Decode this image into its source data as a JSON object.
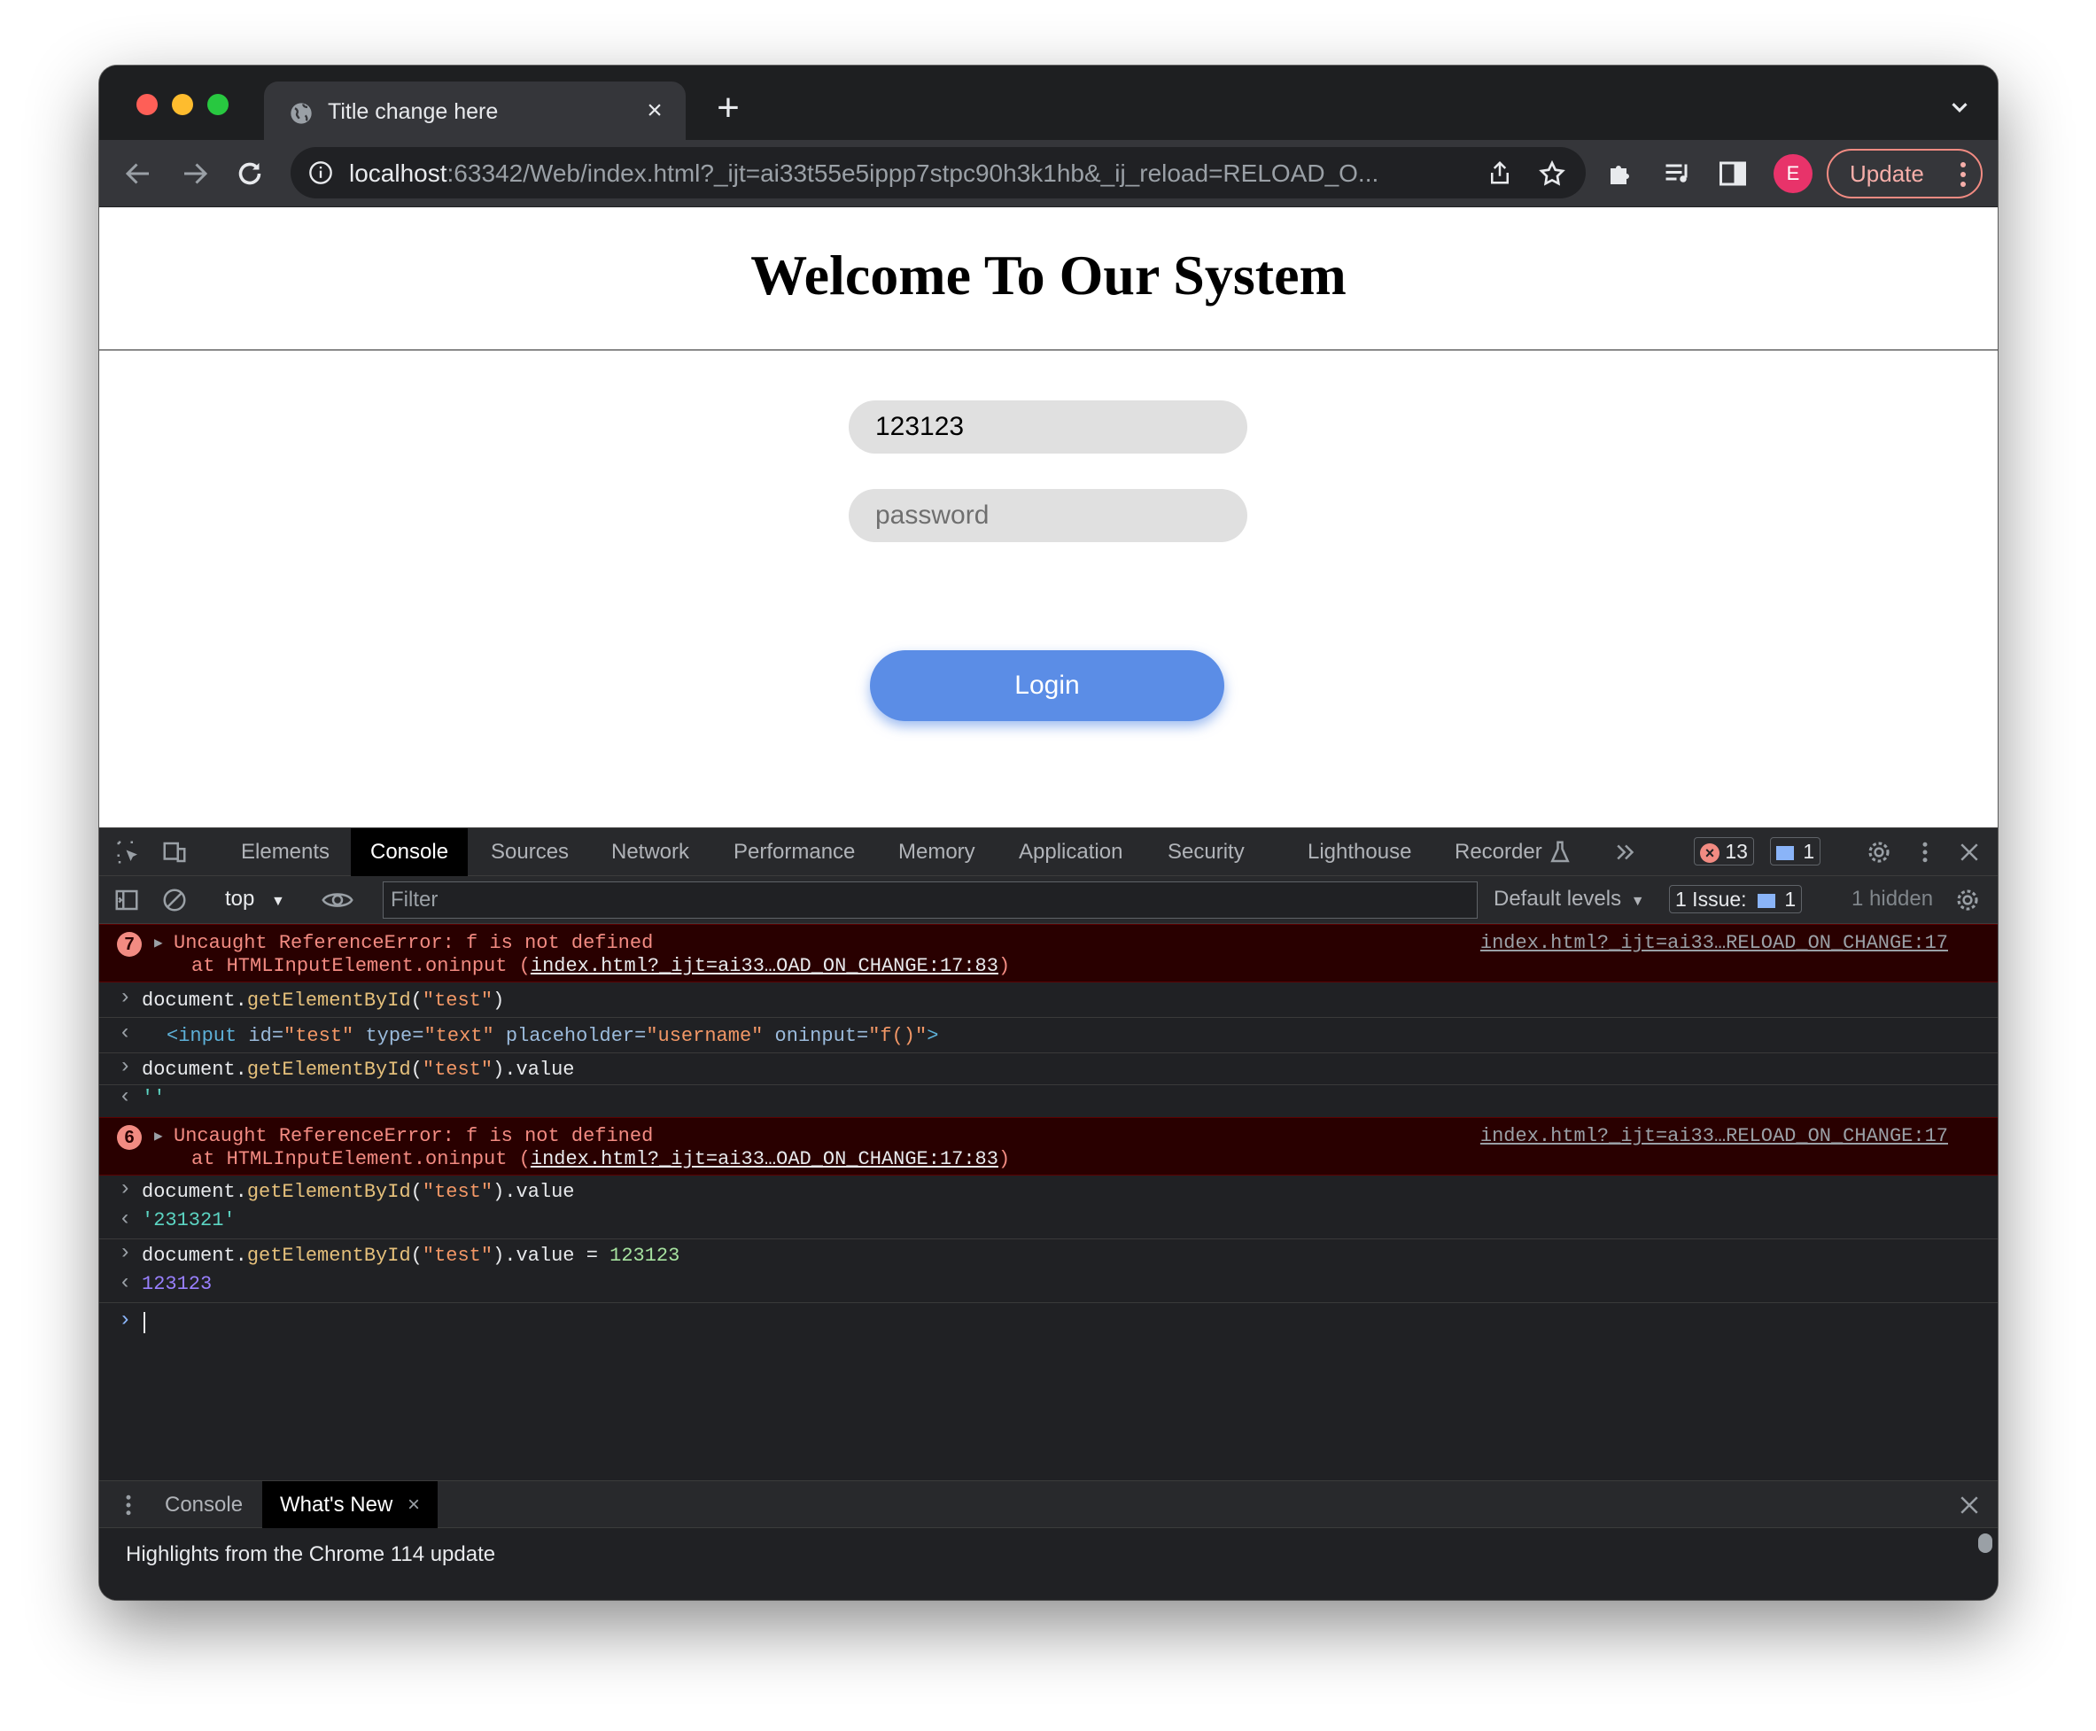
{
  "browser": {
    "tab_title": "Title change here",
    "new_tab_symbol": "+",
    "url_host": "localhost",
    "url_rest": ":63342/Web/index.html?_ijt=ai33t55e5ippp7stpc90h3k1hb&_ij_reload=RELOAD_O...",
    "profile_initial": "E",
    "update_label": "Update"
  },
  "page": {
    "heading": "Welcome To Our System",
    "username_value": "123123",
    "username_placeholder": "username",
    "password_placeholder": "password",
    "login_label": "Login"
  },
  "devtools": {
    "tabs": [
      "Elements",
      "Console",
      "Sources",
      "Network",
      "Performance",
      "Memory",
      "Application",
      "Security",
      "Lighthouse",
      "Recorder"
    ],
    "active_tab": "Console",
    "error_count": "13",
    "message_count": "1",
    "context": "top",
    "filter_placeholder": "Filter",
    "levels": "Default levels",
    "issues_label": "1 Issue:",
    "issues_count": "1",
    "hidden": "1 hidden",
    "console": {
      "err1_count": "7",
      "err2_count": "6",
      "error_message": "Uncaught ReferenceError: f is not defined",
      "error_at_prefix": "at HTMLInputElement.oninput (",
      "error_at_link": "index.html?_ijt=ai33…OAD_ON_CHANGE:17:83",
      "error_at_suffix": ")",
      "error_source": "index.html?_ijt=ai33…RELOAD_ON_CHANGE:17",
      "cmd1_obj": "document.",
      "cmd1_fn": "getElementById",
      "cmd_arg_open": "(",
      "cmd_arg": "\"test\"",
      "cmd_arg_close": ")",
      "cmd_value": ".value",
      "cmd_assign": " = ",
      "cmd_assign_num": "123123",
      "result_tag_open": "<input",
      "result_attr1": " id=",
      "result_val1": "\"test\"",
      "result_attr2": " type=",
      "result_val2": "\"text\"",
      "result_attr3": " placeholder=",
      "result_val3": "\"username\"",
      "result_attr4": " oninput=",
      "result_val4": "\"f()\"",
      "result_tag_close": ">",
      "result_empty": "''",
      "result_str": "'231321'",
      "result_num": "123123"
    },
    "drawer_tabs": [
      "Console",
      "What's New"
    ],
    "highlights": "Highlights from the Chrome 114 update"
  }
}
